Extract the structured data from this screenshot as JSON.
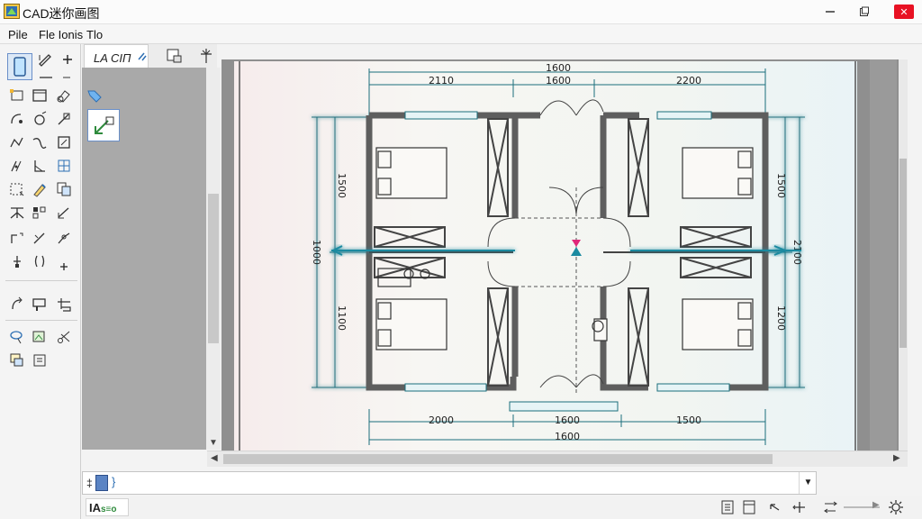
{
  "window": {
    "title": "CAD迷你画图",
    "minimize_icon": "minimize-icon",
    "maximize_icon": "maximize-icon",
    "close_icon": "close-icon"
  },
  "menu": {
    "items": [
      "Pile",
      "Fle Ionis",
      "Tlo"
    ]
  },
  "tabs": {
    "active_label": "LA CIΠ",
    "icons": [
      "tab-action-icon",
      "print-icon",
      "pin-icon"
    ]
  },
  "command_line": {
    "prompt": "‡",
    "value": ""
  },
  "status": {
    "left_label": "IA",
    "left_suffix": "s≡o"
  },
  "accent_colors": {
    "dimension": "#1b6e7c",
    "wall": "#5e5e5e",
    "cursor_marker": "#e0287a",
    "glow": "#7fe0f0"
  },
  "drawing": {
    "dims_top": {
      "overall": "1600",
      "left": "2110",
      "center": "1600",
      "right": "2200"
    },
    "dims_bottom": {
      "left": "2000",
      "center": "1600",
      "right": "1500",
      "overall": "1600"
    },
    "dims_left": {
      "overall": "1000",
      "top": "1500",
      "bottom": "1100"
    },
    "dims_right": {
      "overall": "2100",
      "top": "1500",
      "bottom": "1200"
    }
  }
}
